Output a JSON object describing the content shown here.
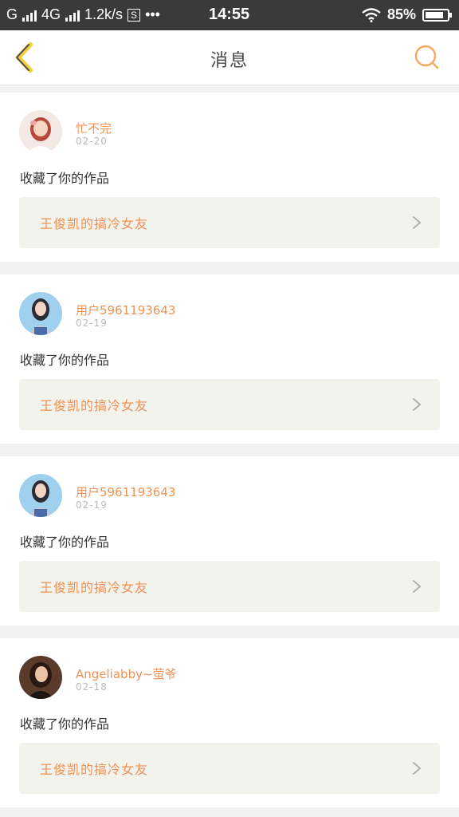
{
  "status_bar": {
    "carrier1": "G",
    "carrier2": "4G",
    "speed": "1.2k/s",
    "s_icon": "S",
    "dots": "•••",
    "time": "14:55",
    "battery": "85%",
    "battery_level": 0.85
  },
  "header": {
    "title": "消息",
    "back_icon": "chevron-left-icon",
    "search_icon": "search-icon"
  },
  "colors": {
    "accent": "#ef9152",
    "back": "#f3cf3c"
  },
  "messages": [
    {
      "user": "忙不完",
      "date": "02-20",
      "action": "收藏了你的作品",
      "work": "王俊凯的搞冷女友"
    },
    {
      "user": "用户5961193643",
      "date": "02-19",
      "action": "收藏了你的作品",
      "work": "王俊凯的搞冷女友"
    },
    {
      "user": "用户5961193643",
      "date": "02-19",
      "action": "收藏了你的作品",
      "work": "王俊凯的搞冷女友"
    },
    {
      "user": "Angeliabby~萤爷",
      "date": "02-18",
      "action": "收藏了你的作品",
      "work": "王俊凯的搞冷女友"
    }
  ]
}
